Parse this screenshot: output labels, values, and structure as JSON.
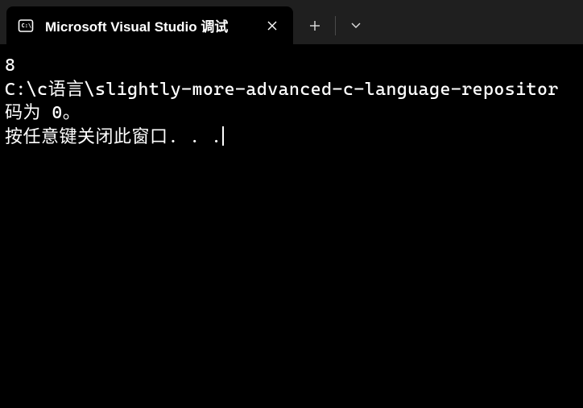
{
  "tab": {
    "title": "Microsoft Visual Studio 调试",
    "icon_name": "console-icon"
  },
  "terminal": {
    "line1": "8",
    "line2": "C:\\c语言\\slightly-more-advanced-c-language-repositor",
    "line3": "码为 0。",
    "line4": "按任意键关闭此窗口. . ."
  }
}
